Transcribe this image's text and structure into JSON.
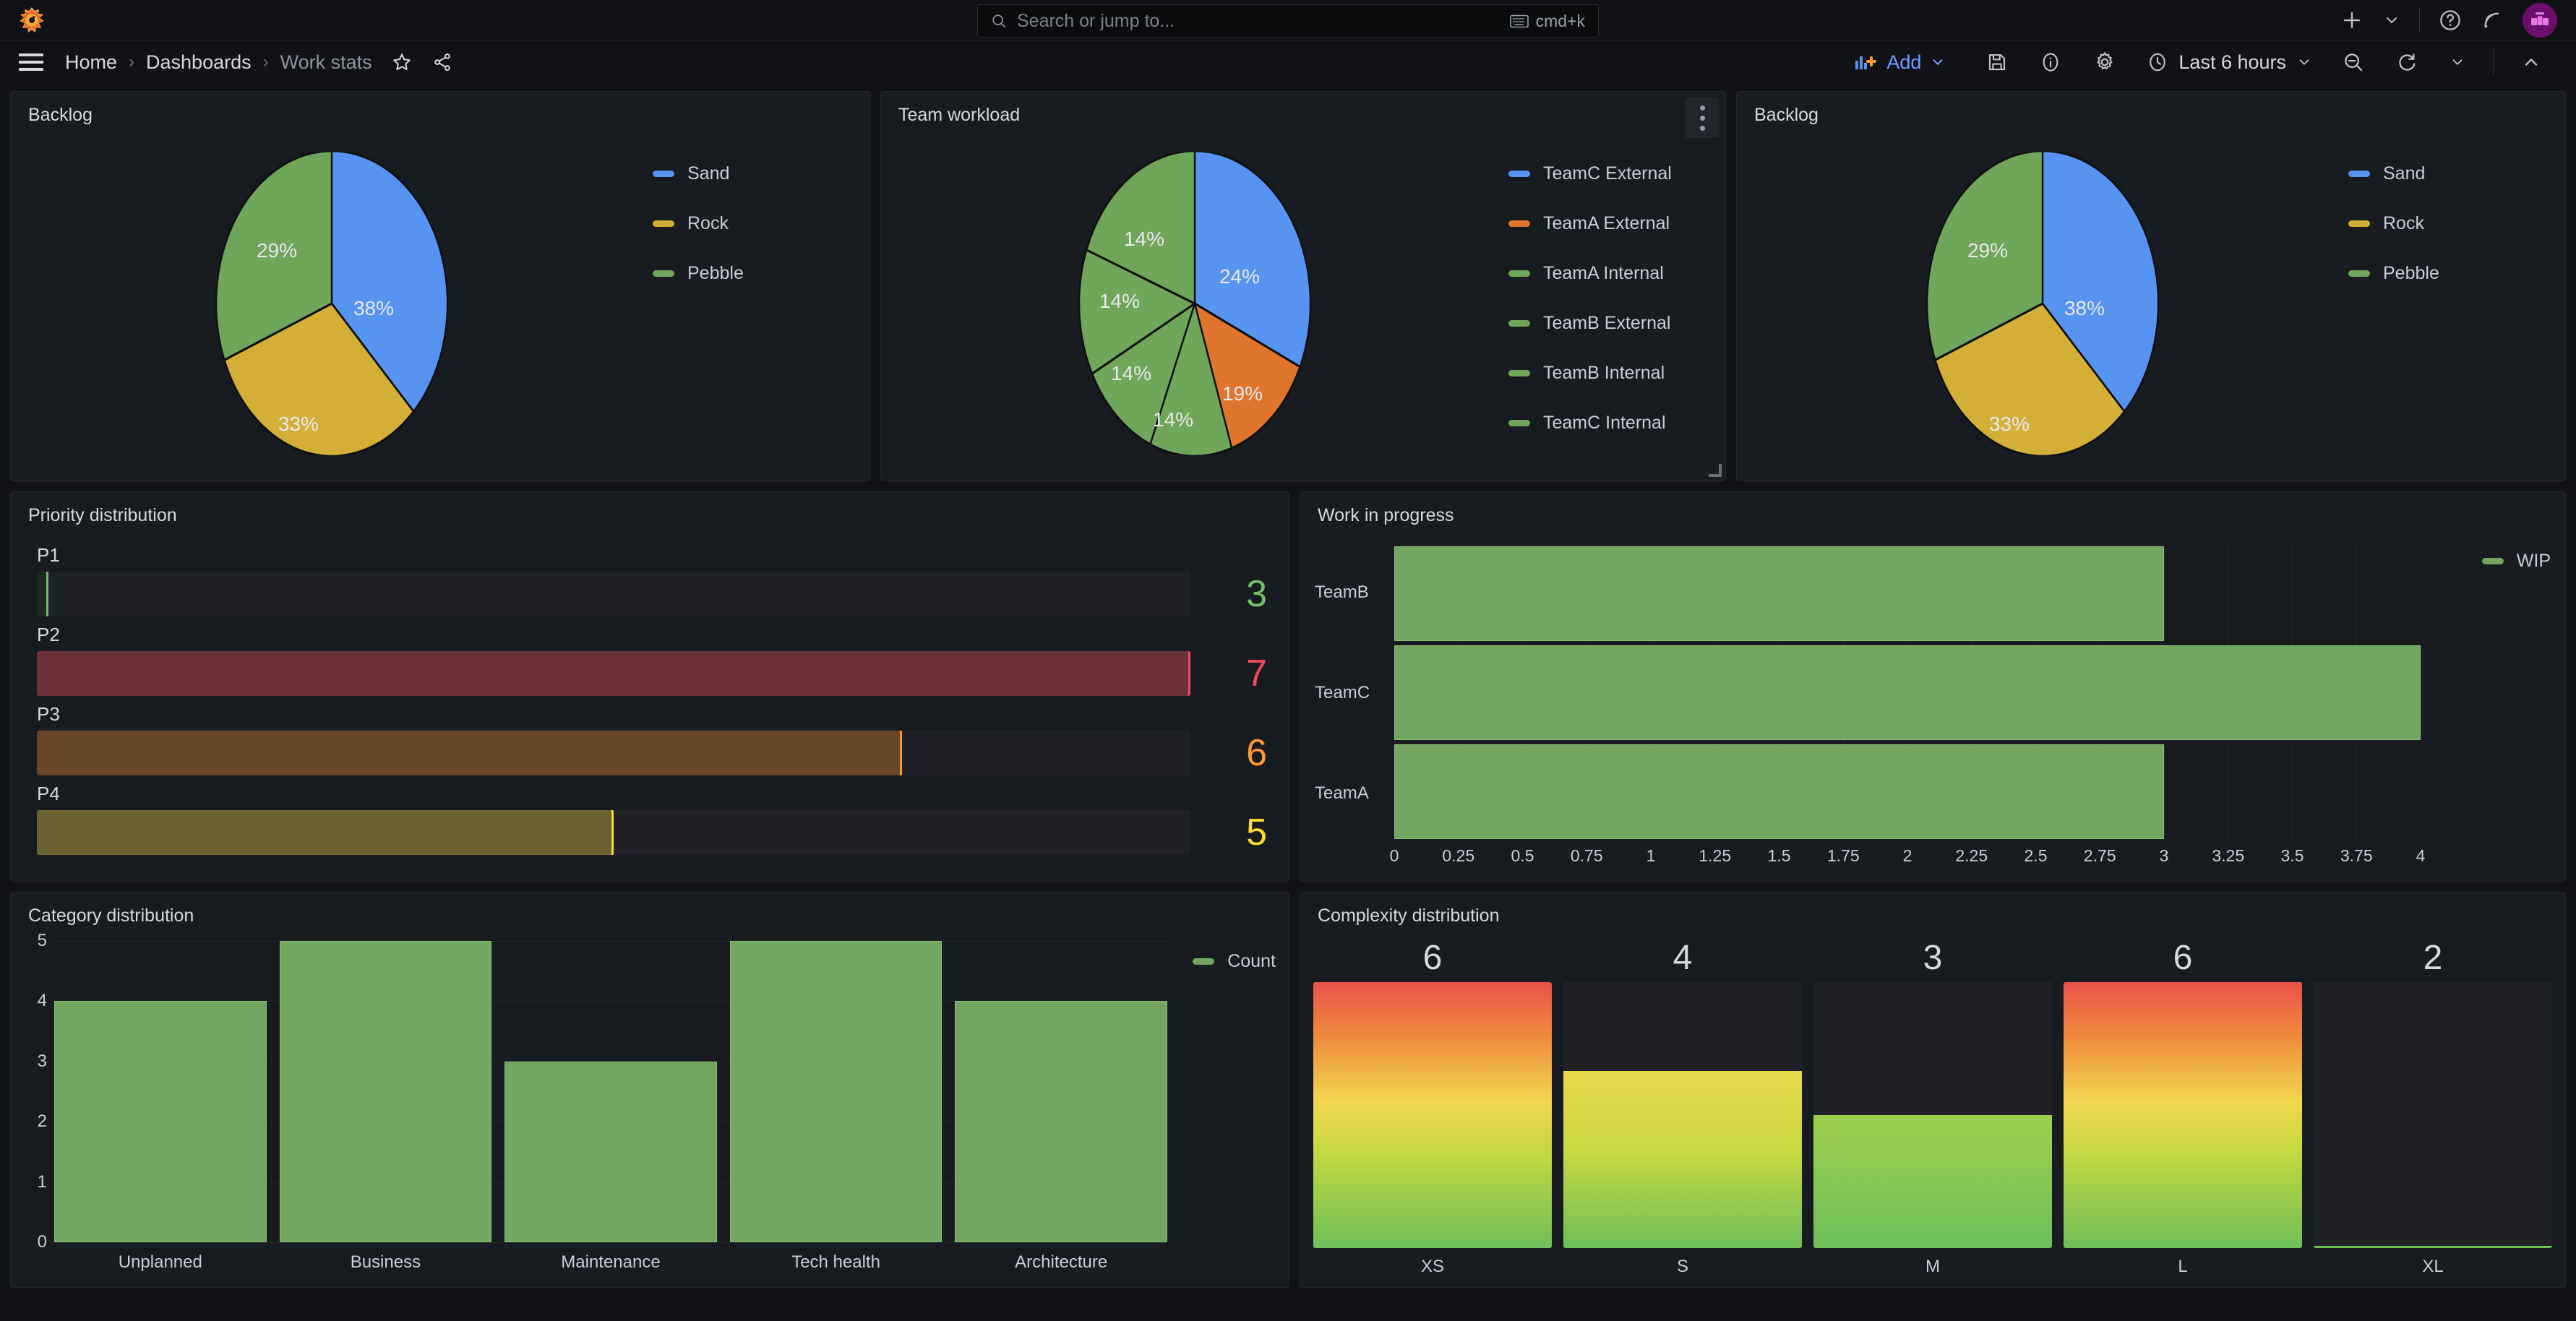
{
  "topnav": {
    "logo_icon": "grafana-logo-icon",
    "search": {
      "placeholder": "Search or jump to...",
      "icon": "search-icon",
      "kbd_icon": "keyboard-icon",
      "kbd_hint": "cmd+k"
    },
    "actions": [
      {
        "icon": "plus-icon",
        "name": "create-new-button"
      },
      {
        "icon": "chevron-down-icon",
        "name": "create-new-chevron"
      },
      {
        "icon": "help-circle-icon",
        "name": "help-button"
      },
      {
        "icon": "rss-news-icon",
        "name": "news-button"
      },
      {
        "icon": "avatar-icon",
        "name": "profile-avatar"
      }
    ]
  },
  "dashnav": {
    "menu_icon": "hamburger-menu-icon",
    "breadcrumb": [
      {
        "label": "Home",
        "current": false
      },
      {
        "label": "Dashboards",
        "current": false
      },
      {
        "label": "Work stats",
        "current": true
      }
    ],
    "crumb_separator": "›",
    "star_icon": "star-outline-icon",
    "share_icon": "share-nodes-icon",
    "add_label": "Add",
    "add_icon": "add-panel-icon",
    "add_chevron": "chevron-down-icon",
    "tools": [
      {
        "icon": "save-disk-icon",
        "name": "save-dashboard-button"
      },
      {
        "icon": "info-circle-icon",
        "name": "dashboard-info-button"
      },
      {
        "icon": "gear-icon",
        "name": "dashboard-settings-button"
      }
    ],
    "time_range": "Last 6 hours",
    "time_icon": "clock-icon",
    "time_chevron": "chevron-down-icon",
    "zoom_out_icon": "zoom-out-icon",
    "refresh_icon": "refresh-icon",
    "refresh_chevron": "chevron-down-icon",
    "collapse_icon": "chevron-up-icon"
  },
  "panels": {
    "backlog_left": {
      "title": "Backlog"
    },
    "team_workload": {
      "title": "Team workload",
      "menu_icon": "panel-menu-icon"
    },
    "backlog_right": {
      "title": "Backlog"
    },
    "priority": {
      "title": "Priority distribution"
    },
    "wip": {
      "title": "Work in progress"
    },
    "category": {
      "title": "Category distribution"
    },
    "complexity": {
      "title": "Complexity distribution"
    }
  },
  "chart_data": [
    {
      "id": "backlog_left",
      "type": "pie",
      "title": "Backlog",
      "legend_position": "right",
      "labels": [
        "Sand",
        "Rock",
        "Pebble"
      ],
      "values": [
        38,
        33,
        29
      ],
      "value_labels": [
        "38%",
        "33%",
        "29%"
      ],
      "colors": [
        "#5794f2",
        "#d4af37",
        "#6fa65a"
      ]
    },
    {
      "id": "team_workload",
      "type": "pie",
      "title": "Team workload",
      "legend_position": "right",
      "labels": [
        "TeamC External",
        "TeamA External",
        "TeamA Internal",
        "TeamB External",
        "TeamB Internal",
        "TeamC Internal"
      ],
      "values": [
        24,
        19,
        14,
        14,
        14,
        14
      ],
      "value_labels": [
        "24%",
        "19%",
        "14%",
        "14%",
        "14%",
        "14%"
      ],
      "colors": [
        "#5794f2",
        "#e0752d",
        "#6fa65a",
        "#6fa65a",
        "#6fa65a",
        "#6fa65a"
      ]
    },
    {
      "id": "backlog_right",
      "type": "pie",
      "title": "Backlog",
      "legend_position": "right",
      "labels": [
        "Sand",
        "Rock",
        "Pebble"
      ],
      "values": [
        38,
        33,
        29
      ],
      "value_labels": [
        "38%",
        "33%",
        "29%"
      ],
      "colors": [
        "#5794f2",
        "#d4af37",
        "#6fa65a"
      ]
    },
    {
      "id": "priority",
      "type": "bar",
      "title": "Priority distribution",
      "orientation": "horizontal",
      "categories": [
        "P1",
        "P2",
        "P3",
        "P4"
      ],
      "values": [
        3,
        7,
        6,
        5
      ],
      "max": 7,
      "colors": [
        "#73bf69",
        "#f2495c",
        "#ff9830",
        "#fade2a"
      ],
      "fill_colors": [
        "#1f2b22",
        "#6b3338",
        "#68462a",
        "#6b6332"
      ]
    },
    {
      "id": "wip",
      "type": "bar",
      "title": "Work in progress",
      "orientation": "horizontal",
      "categories": [
        "TeamB",
        "TeamC",
        "TeamA"
      ],
      "values": [
        3,
        4,
        3
      ],
      "xlabel": "",
      "ylabel": "",
      "xlim": [
        0,
        4
      ],
      "xticks": [
        "0",
        "0.25",
        "0.5",
        "0.75",
        "1",
        "1.25",
        "1.5",
        "1.75",
        "2",
        "2.25",
        "2.5",
        "2.75",
        "3",
        "3.25",
        "3.5",
        "3.75",
        "4"
      ],
      "legend": [
        "WIP"
      ],
      "legend_position": "right",
      "color": "#73a660",
      "grid": true
    },
    {
      "id": "category",
      "type": "bar",
      "title": "Category distribution",
      "orientation": "vertical",
      "categories": [
        "Unplanned",
        "Business",
        "Maintenance",
        "Tech health",
        "Architecture"
      ],
      "values": [
        4,
        5,
        3,
        5,
        4
      ],
      "ylim": [
        0,
        5
      ],
      "yticks": [
        "0",
        "1",
        "2",
        "3",
        "4",
        "5"
      ],
      "legend": [
        "Count"
      ],
      "legend_position": "right",
      "color": "#73a660",
      "grid": true
    },
    {
      "id": "complexity",
      "type": "bar",
      "title": "Complexity distribution",
      "orientation": "vertical",
      "categories": [
        "XS",
        "S",
        "M",
        "L",
        "XL"
      ],
      "values": [
        6,
        4,
        3,
        6,
        2
      ],
      "max": 6,
      "gradient": [
        "#6fbf5a",
        "#c9d93f",
        "#f2d750",
        "#ef8a3c",
        "#e8524a"
      ]
    }
  ]
}
